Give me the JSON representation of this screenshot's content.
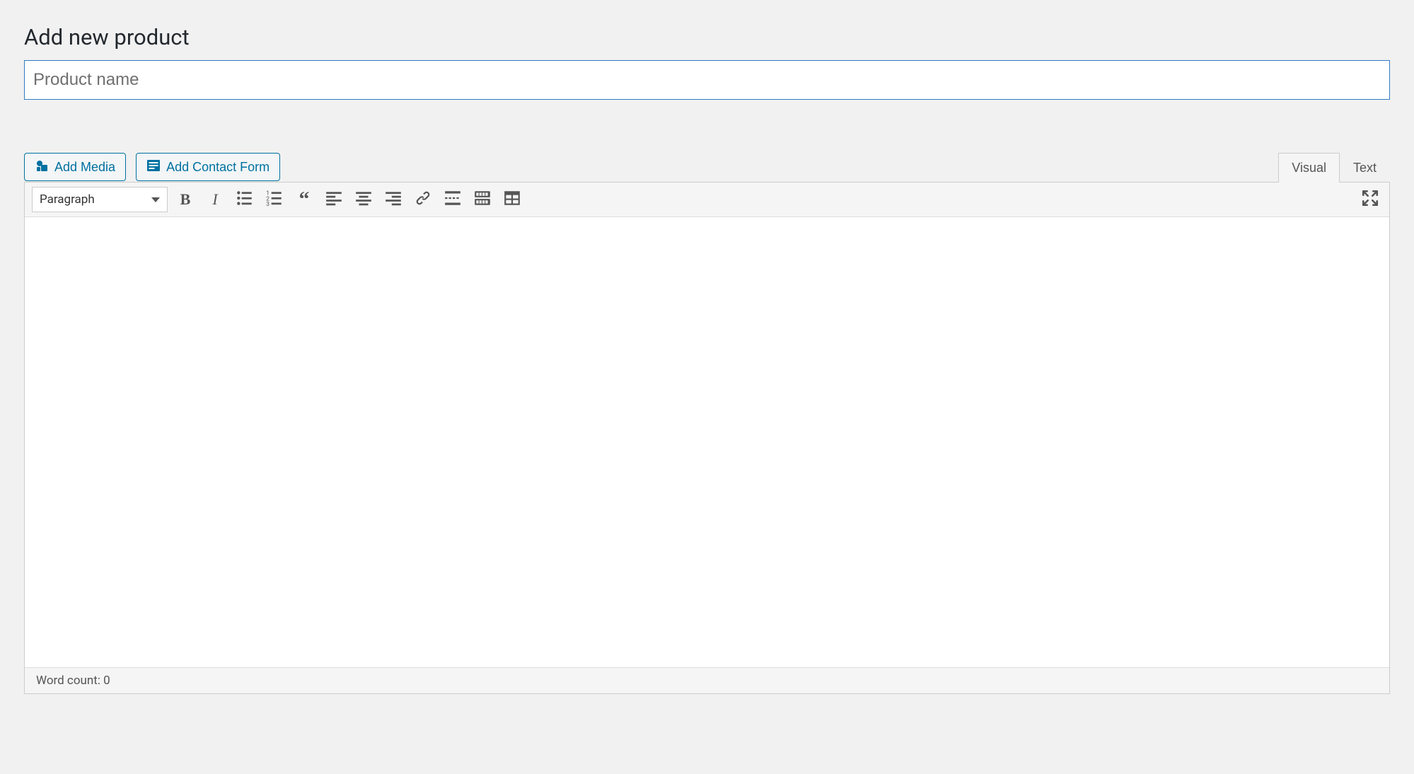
{
  "page": {
    "title": "Add new product"
  },
  "titleField": {
    "placeholder": "Product name",
    "value": ""
  },
  "mediaButtons": {
    "addMedia": "Add Media",
    "addContactForm": "Add Contact Form"
  },
  "editorTabs": {
    "visual": "Visual",
    "text": "Text",
    "active": "visual"
  },
  "toolbar": {
    "formatLabel": "Paragraph",
    "buttons": [
      {
        "name": "bold"
      },
      {
        "name": "italic"
      },
      {
        "name": "bullet-list"
      },
      {
        "name": "numbered-list"
      },
      {
        "name": "blockquote"
      },
      {
        "name": "align-left"
      },
      {
        "name": "align-center"
      },
      {
        "name": "align-right"
      },
      {
        "name": "link"
      },
      {
        "name": "read-more"
      },
      {
        "name": "toolbar-toggle"
      },
      {
        "name": "table"
      }
    ],
    "fullscreen": "fullscreen"
  },
  "editor": {
    "content": ""
  },
  "statusBar": {
    "wordCountLabel": "Word count: 0"
  }
}
